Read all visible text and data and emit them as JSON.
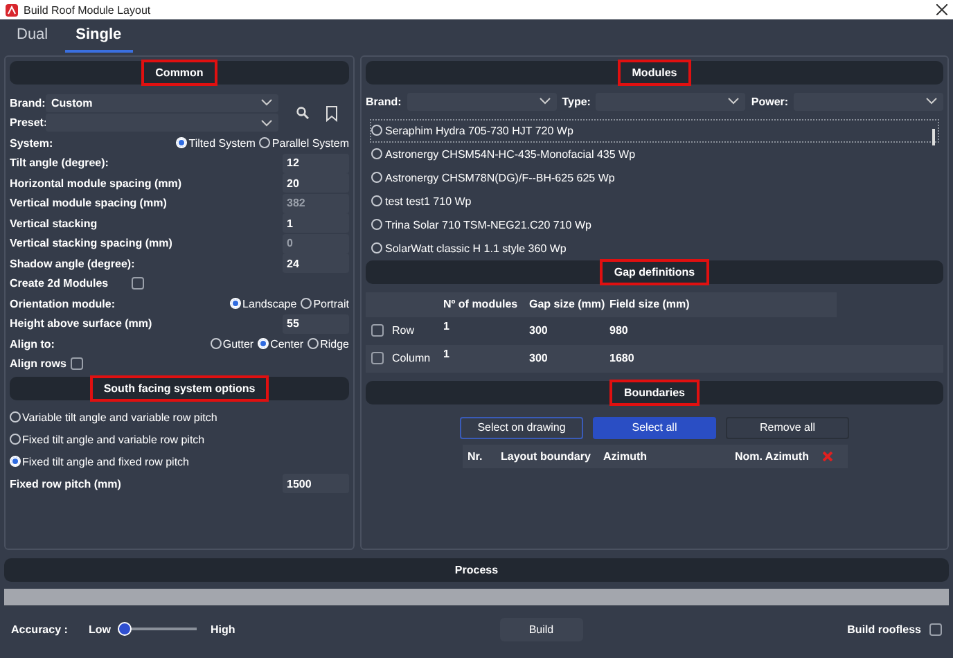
{
  "window": {
    "title": "Build Roof Module Layout"
  },
  "tabs": [
    {
      "label": "Dual",
      "selected": false
    },
    {
      "label": "Single",
      "selected": true
    }
  ],
  "common": {
    "title": "Common",
    "highlighted": true,
    "brand": {
      "label": "Brand:",
      "value": "Custom"
    },
    "preset": {
      "label": "Preset:"
    },
    "rows": [
      {
        "kind": "radio",
        "label": "System:",
        "options": [
          {
            "label": "Tilted System",
            "selected": true
          },
          {
            "label": "Parallel System",
            "selected": false
          }
        ]
      },
      {
        "kind": "field",
        "label": "Tilt angle (degree):",
        "value": "12",
        "disabled": false
      },
      {
        "kind": "field",
        "label": "Horizontal module spacing (mm)",
        "value": "20",
        "disabled": false
      },
      {
        "kind": "field",
        "label": "Vertical module spacing (mm)",
        "value": "382",
        "disabled": true
      },
      {
        "kind": "field",
        "label": "Vertical stacking",
        "value": "1",
        "disabled": false
      },
      {
        "kind": "field",
        "label": "Vertical stacking spacing (mm)",
        "value": "0",
        "disabled": true
      },
      {
        "kind": "field",
        "label": "Shadow angle (degree):",
        "value": "24",
        "disabled": false
      },
      {
        "kind": "check",
        "label": "Create 2d Modules",
        "checked": false
      },
      {
        "kind": "radio",
        "label": "Orientation module:",
        "options": [
          {
            "label": "Landscape",
            "selected": true
          },
          {
            "label": "Portrait",
            "selected": false
          }
        ]
      },
      {
        "kind": "field",
        "label": "Height above surface (mm)",
        "value": "55",
        "disabled": false
      },
      {
        "kind": "radio",
        "label": "Align to:",
        "options": [
          {
            "label": "Gutter",
            "selected": false
          },
          {
            "label": "Center",
            "selected": true
          },
          {
            "label": "Ridge",
            "selected": false
          }
        ]
      },
      {
        "kind": "inlinecheck",
        "label": "Align rows",
        "checked": false
      }
    ]
  },
  "south": {
    "title": "South facing system options",
    "highlighted": true,
    "options": [
      {
        "label": "Variable tilt angle and variable row pitch",
        "selected": false
      },
      {
        "label": "Fixed tilt angle and variable row pitch",
        "selected": false
      },
      {
        "label": "Fixed tilt angle and fixed row pitch",
        "selected": true
      }
    ],
    "pitch": {
      "label": "Fixed row pitch (mm)",
      "value": "1500"
    }
  },
  "modules": {
    "title": "Modules",
    "highlighted": true,
    "filters": [
      {
        "label": "Brand:"
      },
      {
        "label": "Type:"
      },
      {
        "label": "Power:"
      }
    ],
    "items": [
      {
        "label": "Seraphim Hydra 705-730 HJT 720 Wp",
        "selected": false
      },
      {
        "label": "Astronergy CHSM54N-HC-435-Monofacial 435 Wp",
        "selected": false
      },
      {
        "label": "Astronergy CHSM78N(DG)/F--BH-625 625 Wp",
        "selected": false
      },
      {
        "label": "test test1 710 Wp",
        "selected": false
      },
      {
        "label": "Trina Solar 710 TSM-NEG21.C20 710 Wp",
        "selected": false
      },
      {
        "label": "SolarWatt classic H 1.1 style 360 Wp",
        "selected": false
      }
    ]
  },
  "gaps": {
    "title": "Gap definitions",
    "highlighted": true,
    "columns": [
      "Nº of modules",
      "Gap size (mm)",
      "Field size (mm)"
    ],
    "rows": [
      {
        "label": "Row",
        "checked": false,
        "modules": "1",
        "gap": "300",
        "field": "980"
      },
      {
        "label": "Column",
        "checked": false,
        "modules": "1",
        "gap": "300",
        "field": "1680"
      }
    ]
  },
  "boundaries": {
    "title": "Boundaries",
    "highlighted": true,
    "buttons": [
      {
        "label": "Select on drawing",
        "kind": "outline"
      },
      {
        "label": "Select all",
        "kind": "primary"
      },
      {
        "label": "Remove all",
        "kind": "plain"
      }
    ],
    "columns": [
      "Nr.",
      "Layout boundary",
      "Azimuth",
      "Nom. Azimuth"
    ]
  },
  "process": {
    "title": "Process",
    "highlighted": false
  },
  "progress": {
    "level": 1
  },
  "accuracy": {
    "label": "Accuracy :",
    "low": "Low",
    "high": "High",
    "level": 0
  },
  "build": {
    "label": "Build"
  },
  "roofless": {
    "label": "Build roofless",
    "checked": false
  }
}
